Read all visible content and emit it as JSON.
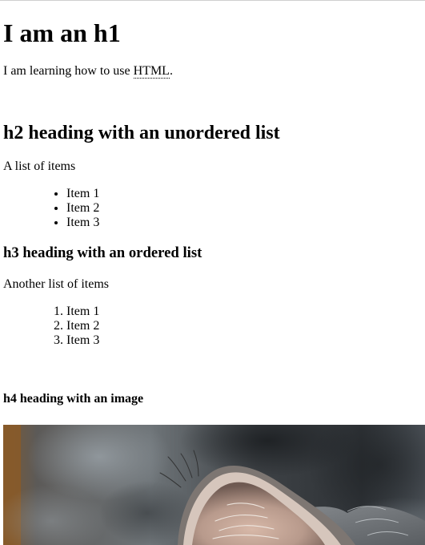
{
  "page": {
    "h1": "I am an h1",
    "intro": {
      "before": "I am learning how to use ",
      "abbr": "HTML",
      "after": "."
    },
    "h2": "h2 heading with an unordered list",
    "unordered_intro": "A list of items",
    "unordered_items": [
      "Item 1",
      "Item 2",
      "Item 3"
    ],
    "h3": "h3 heading with an ordered list",
    "ordered_intro": "Another list of items",
    "ordered_items": [
      "Item 1",
      "Item 2",
      "Item 3"
    ],
    "h4": "h4 heading with an image"
  },
  "image": {
    "subject": "cat ear close-up photo"
  }
}
